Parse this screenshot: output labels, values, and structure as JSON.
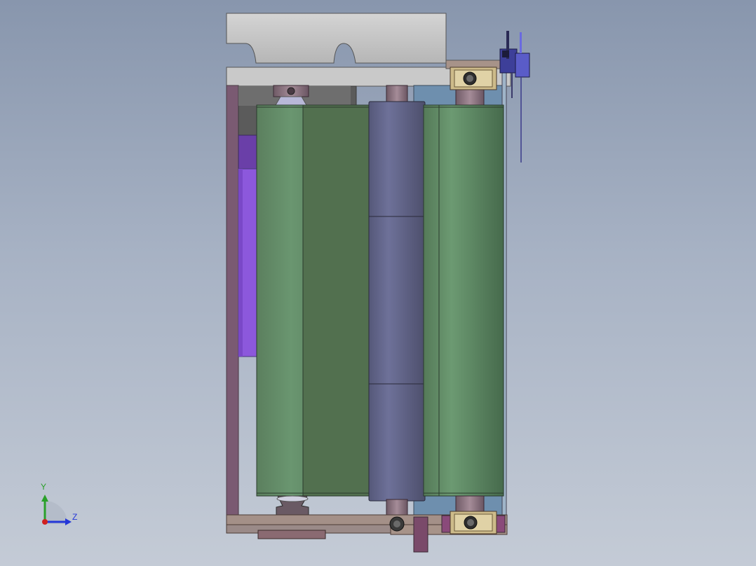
{
  "viewport": {
    "background_top": "#8896ad",
    "background_bottom": "#c4cbd6"
  },
  "triad": {
    "y_label": "Y",
    "z_label": "Z",
    "y_color": "#2aa02a",
    "z_color": "#2437d8",
    "x_color": "#d02020"
  },
  "model": {
    "colors": {
      "plate": "#c8c8c8",
      "plate_edge": "#555555",
      "frame": "#7a5a72",
      "roller_green": "#5f8a64",
      "roller_green_dark": "#4f6f53",
      "roller_purple": "#5e6088",
      "bearing": "#cdbb8a",
      "blue_panel": "#6a8fb0",
      "violet": "#8a55d6",
      "brown": "#9a7a78"
    },
    "parts": [
      "top-mounting-plate",
      "side-frame-left",
      "left-green-roller",
      "center-drive-roller",
      "right-green-roller",
      "top-bearing-block",
      "bottom-bearing-block",
      "bottom-base-bracket",
      "sensor-bracket",
      "violet-side-guide"
    ]
  }
}
